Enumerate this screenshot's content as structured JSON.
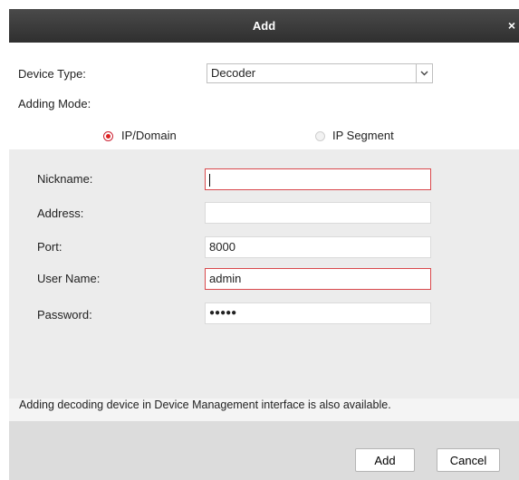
{
  "window": {
    "title": "Add",
    "close_glyph": "×"
  },
  "device_type": {
    "label": "Device Type:",
    "value": "Decoder"
  },
  "adding_mode": {
    "label": "Adding Mode:",
    "options": [
      {
        "label": "IP/Domain",
        "selected": true
      },
      {
        "label": "IP Segment",
        "selected": false
      }
    ]
  },
  "form": {
    "nickname": {
      "label": "Nickname:",
      "value": ""
    },
    "address": {
      "label": "Address:",
      "value": ""
    },
    "port": {
      "label": "Port:",
      "value": "8000"
    },
    "username": {
      "label": "User Name:",
      "value": "admin"
    },
    "password": {
      "label": "Password:",
      "value": "●●●●●"
    }
  },
  "info_text": "Adding decoding device in Device Management interface is also available.",
  "buttons": {
    "add": "Add",
    "cancel": "Cancel"
  },
  "colors": {
    "accent_error": "#d9484c",
    "radio_selected": "#dd2222",
    "titlebar": "#3c3c3c"
  }
}
